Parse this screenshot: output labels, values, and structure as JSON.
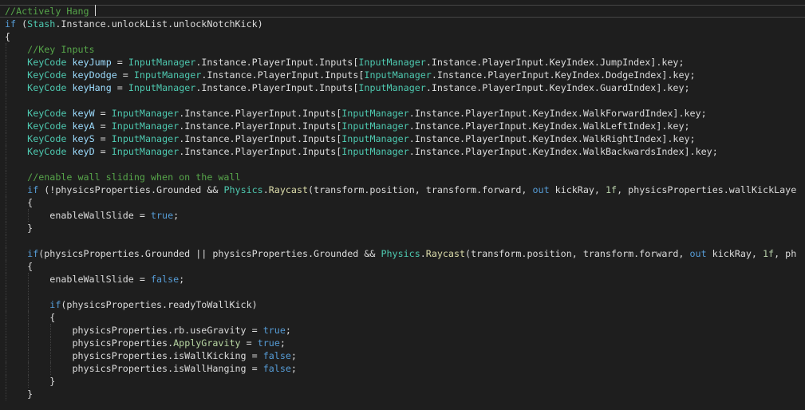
{
  "editor": {
    "name": "code-editor",
    "colors": {
      "background": "#1e1e1e",
      "text": "#dcdcdc",
      "comment": "#57a64a",
      "keyword": "#569cd6",
      "type": "#4ec9b0",
      "method": "#dcdcaa",
      "variable": "#9cdcfe",
      "number": "#b5cea8",
      "enum": "#b8d7a3"
    },
    "current_line": 0,
    "lines": [
      {
        "indent": 0,
        "tokens": [
          [
            "comment",
            "//Actively Hang"
          ]
        ]
      },
      {
        "indent": 0,
        "tokens": [
          [
            "keyword",
            "if"
          ],
          [
            "text",
            " ("
          ],
          [
            "type",
            "Stash"
          ],
          [
            "text",
            ".Instance.unlockList.unlockNotchKick)"
          ]
        ]
      },
      {
        "indent": 0,
        "tokens": [
          [
            "text",
            "{"
          ]
        ]
      },
      {
        "indent": 1,
        "tokens": [
          [
            "comment",
            "//Key Inputs"
          ]
        ]
      },
      {
        "indent": 1,
        "tokens": [
          [
            "type",
            "KeyCode"
          ],
          [
            "text",
            " "
          ],
          [
            "var",
            "keyJump"
          ],
          [
            "text",
            " = "
          ],
          [
            "type",
            "InputManager"
          ],
          [
            "text",
            ".Instance.PlayerInput.Inputs["
          ],
          [
            "type",
            "InputManager"
          ],
          [
            "text",
            ".Instance.PlayerInput.KeyIndex.JumpIndex].key;"
          ]
        ]
      },
      {
        "indent": 1,
        "tokens": [
          [
            "type",
            "KeyCode"
          ],
          [
            "text",
            " "
          ],
          [
            "var",
            "keyDodge"
          ],
          [
            "text",
            " = "
          ],
          [
            "type",
            "InputManager"
          ],
          [
            "text",
            ".Instance.PlayerInput.Inputs["
          ],
          [
            "type",
            "InputManager"
          ],
          [
            "text",
            ".Instance.PlayerInput.KeyIndex.DodgeIndex].key;"
          ]
        ]
      },
      {
        "indent": 1,
        "tokens": [
          [
            "type",
            "KeyCode"
          ],
          [
            "text",
            " "
          ],
          [
            "var",
            "keyHang"
          ],
          [
            "text",
            " = "
          ],
          [
            "type",
            "InputManager"
          ],
          [
            "text",
            ".Instance.PlayerInput.Inputs["
          ],
          [
            "type",
            "InputManager"
          ],
          [
            "text",
            ".Instance.PlayerInput.KeyIndex.GuardIndex].key;"
          ]
        ]
      },
      {
        "indent": 1,
        "tokens": []
      },
      {
        "indent": 1,
        "tokens": [
          [
            "type",
            "KeyCode"
          ],
          [
            "text",
            " "
          ],
          [
            "var",
            "keyW"
          ],
          [
            "text",
            " = "
          ],
          [
            "type",
            "InputManager"
          ],
          [
            "text",
            ".Instance.PlayerInput.Inputs["
          ],
          [
            "type",
            "InputManager"
          ],
          [
            "text",
            ".Instance.PlayerInput.KeyIndex.WalkForwardIndex].key;"
          ]
        ]
      },
      {
        "indent": 1,
        "tokens": [
          [
            "type",
            "KeyCode"
          ],
          [
            "text",
            " "
          ],
          [
            "var",
            "keyA"
          ],
          [
            "text",
            " = "
          ],
          [
            "type",
            "InputManager"
          ],
          [
            "text",
            ".Instance.PlayerInput.Inputs["
          ],
          [
            "type",
            "InputManager"
          ],
          [
            "text",
            ".Instance.PlayerInput.KeyIndex.WalkLeftIndex].key;"
          ]
        ]
      },
      {
        "indent": 1,
        "tokens": [
          [
            "type",
            "KeyCode"
          ],
          [
            "text",
            " "
          ],
          [
            "var",
            "keyS"
          ],
          [
            "text",
            " = "
          ],
          [
            "type",
            "InputManager"
          ],
          [
            "text",
            ".Instance.PlayerInput.Inputs["
          ],
          [
            "type",
            "InputManager"
          ],
          [
            "text",
            ".Instance.PlayerInput.KeyIndex.WalkRightIndex].key;"
          ]
        ]
      },
      {
        "indent": 1,
        "tokens": [
          [
            "type",
            "KeyCode"
          ],
          [
            "text",
            " "
          ],
          [
            "var",
            "keyD"
          ],
          [
            "text",
            " = "
          ],
          [
            "type",
            "InputManager"
          ],
          [
            "text",
            ".Instance.PlayerInput.Inputs["
          ],
          [
            "type",
            "InputManager"
          ],
          [
            "text",
            ".Instance.PlayerInput.KeyIndex.WalkBackwardsIndex].key;"
          ]
        ]
      },
      {
        "indent": 1,
        "tokens": []
      },
      {
        "indent": 1,
        "tokens": [
          [
            "comment",
            "//enable wall sliding when on the wall"
          ]
        ]
      },
      {
        "indent": 1,
        "tokens": [
          [
            "keyword",
            "if"
          ],
          [
            "text",
            " (!physicsProperties.Grounded && "
          ],
          [
            "type",
            "Physics"
          ],
          [
            "text",
            "."
          ],
          [
            "method",
            "Raycast"
          ],
          [
            "text",
            "(transform.position, transform.forward, "
          ],
          [
            "keyword",
            "out"
          ],
          [
            "text",
            " kickRay, "
          ],
          [
            "number",
            "1f"
          ],
          [
            "text",
            ", physicsProperties.wallKickLaye"
          ]
        ]
      },
      {
        "indent": 1,
        "tokens": [
          [
            "text",
            "{"
          ]
        ]
      },
      {
        "indent": 2,
        "tokens": [
          [
            "text",
            "enableWallSlide = "
          ],
          [
            "keyword",
            "true"
          ],
          [
            "text",
            ";"
          ]
        ]
      },
      {
        "indent": 1,
        "tokens": [
          [
            "text",
            "}"
          ]
        ]
      },
      {
        "indent": 1,
        "tokens": []
      },
      {
        "indent": 1,
        "tokens": [
          [
            "keyword",
            "if"
          ],
          [
            "text",
            "(physicsProperties.Grounded || physicsProperties.Grounded && "
          ],
          [
            "type",
            "Physics"
          ],
          [
            "text",
            "."
          ],
          [
            "method",
            "Raycast"
          ],
          [
            "text",
            "(transform.position, transform.forward, "
          ],
          [
            "keyword",
            "out"
          ],
          [
            "text",
            " kickRay, "
          ],
          [
            "number",
            "1f"
          ],
          [
            "text",
            ", ph"
          ]
        ]
      },
      {
        "indent": 1,
        "tokens": [
          [
            "text",
            "{"
          ]
        ]
      },
      {
        "indent": 2,
        "tokens": [
          [
            "text",
            "enableWallSlide = "
          ],
          [
            "keyword",
            "false"
          ],
          [
            "text",
            ";"
          ]
        ]
      },
      {
        "indent": 2,
        "tokens": []
      },
      {
        "indent": 2,
        "tokens": [
          [
            "keyword",
            "if"
          ],
          [
            "text",
            "(physicsProperties.readyToWallKick)"
          ]
        ]
      },
      {
        "indent": 2,
        "tokens": [
          [
            "text",
            "{"
          ]
        ]
      },
      {
        "indent": 3,
        "tokens": [
          [
            "text",
            "physicsProperties.rb.useGravity = "
          ],
          [
            "keyword",
            "true"
          ],
          [
            "text",
            ";"
          ]
        ]
      },
      {
        "indent": 3,
        "tokens": [
          [
            "text",
            "physicsProperties."
          ],
          [
            "enum",
            "ApplyGravity"
          ],
          [
            "text",
            " = "
          ],
          [
            "keyword",
            "true"
          ],
          [
            "text",
            ";"
          ]
        ]
      },
      {
        "indent": 3,
        "tokens": [
          [
            "text",
            "physicsProperties.isWallKicking = "
          ],
          [
            "keyword",
            "false"
          ],
          [
            "text",
            ";"
          ]
        ]
      },
      {
        "indent": 3,
        "tokens": [
          [
            "text",
            "physicsProperties.isWallHanging = "
          ],
          [
            "keyword",
            "false"
          ],
          [
            "text",
            ";"
          ]
        ]
      },
      {
        "indent": 2,
        "tokens": [
          [
            "text",
            "}"
          ]
        ]
      },
      {
        "indent": 1,
        "tokens": [
          [
            "text",
            "}"
          ]
        ]
      }
    ]
  }
}
